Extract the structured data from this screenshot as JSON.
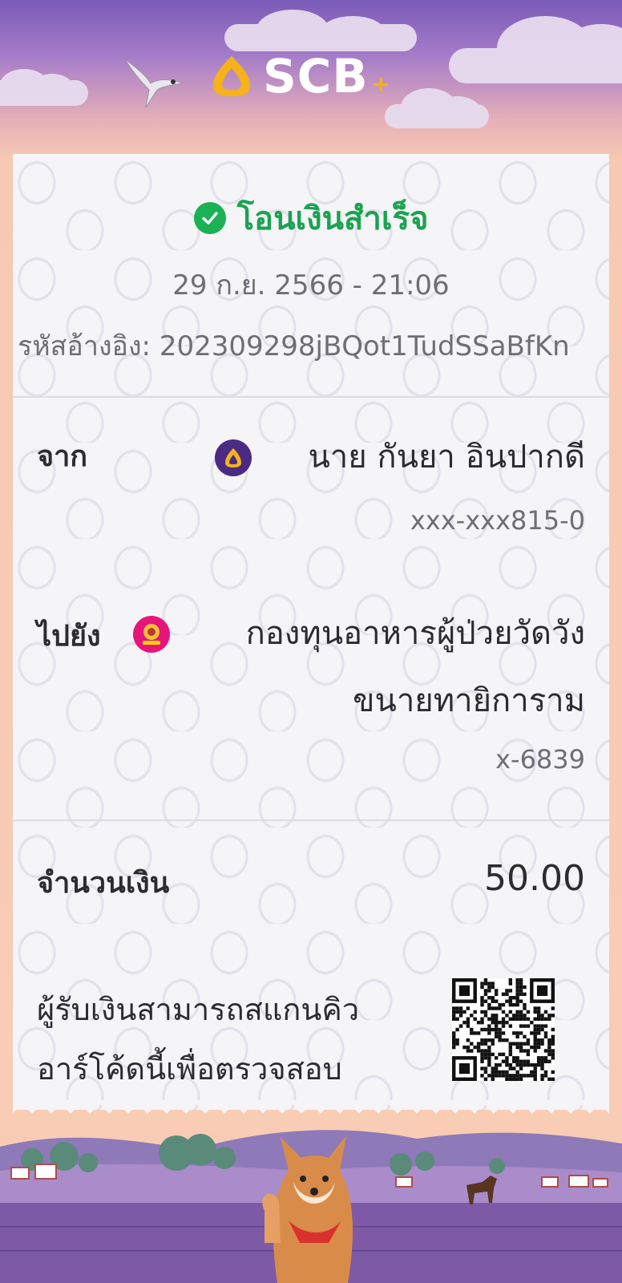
{
  "brand": {
    "name": "SCB",
    "plus": "+"
  },
  "receipt": {
    "status": "โอนเงินสำเร็จ",
    "datetime": "29 ก.ย. 2566 - 21:06",
    "reference": "รหัสอ้างอิง: 202309298jBQot1TudSSaBfKn",
    "from": {
      "label": "จาก",
      "name": "นาย กันยา อินปากดี",
      "account": "xxx-xxx815-0"
    },
    "to": {
      "label": "ไปยัง",
      "name_line1": "กองทุนอาหารผู้ป่วยวัดวัง",
      "name_line2": "ขนายทายิการาม",
      "account": "x-6839"
    },
    "amount": {
      "label": "จำนวนเงิน",
      "value": "50.00"
    },
    "qr_note": {
      "line1": "ผู้รับเงินสามารถสแกนคิว",
      "line2": "อาร์โค้ดนี้เพื่อตรวจสอบ"
    }
  },
  "colors": {
    "success": "#1aa350",
    "brand_purple": "#4b2a83",
    "brand_gold": "#f5b21a",
    "bank_pink": "#e6157a"
  }
}
